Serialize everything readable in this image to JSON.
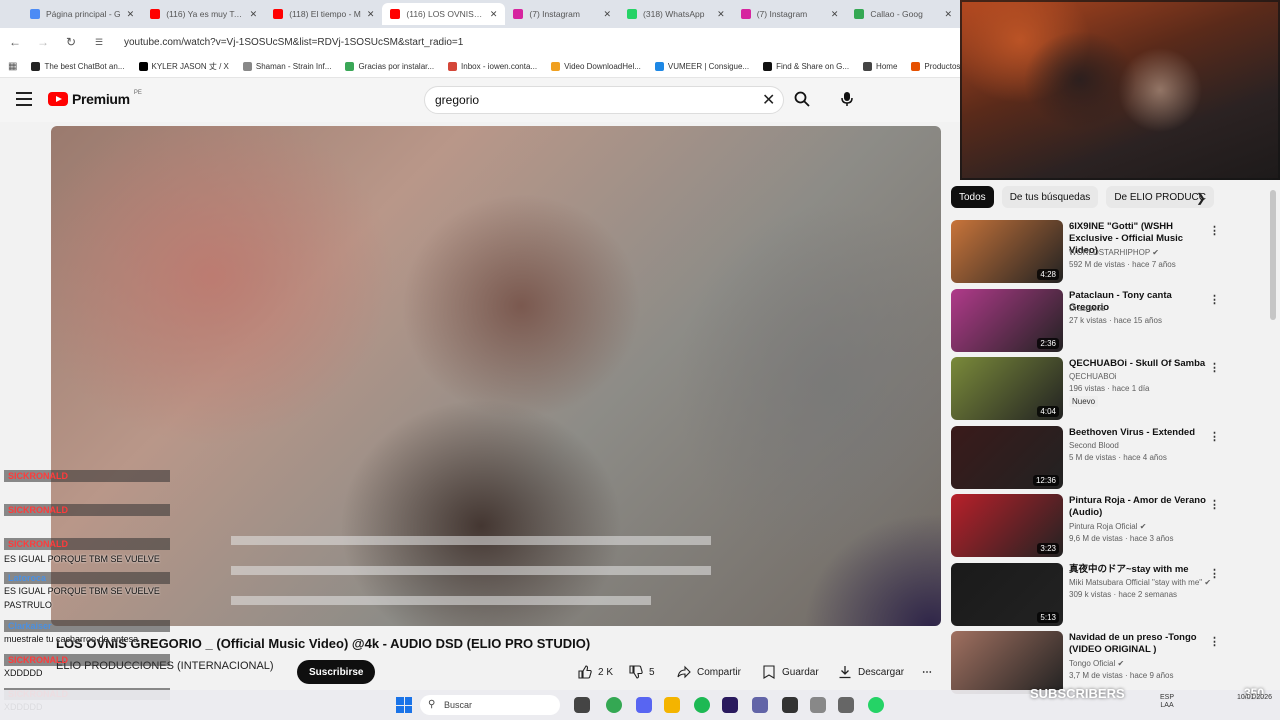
{
  "browser": {
    "tabs": [
      {
        "label": "Página principal - G",
        "color": "#4c8bf5"
      },
      {
        "label": "(116) Ya es muy Tard",
        "color": "#ff0000"
      },
      {
        "label": "(118) El tiempo - M",
        "color": "#ff0000"
      },
      {
        "label": "(116) LOS OVNIS GR",
        "color": "#ff0000",
        "active": true
      },
      {
        "label": "(7) Instagram",
        "color": "#d6249f"
      },
      {
        "label": "(318) WhatsApp",
        "color": "#25d366"
      },
      {
        "label": "(7) Instagram",
        "color": "#d6249f"
      },
      {
        "label": "Callao - Goog",
        "color": "#34a853"
      }
    ],
    "url": "youtube.com/watch?v=Vj-1SOSUcSM&list=RDVj-1SOSUcSM&start_radio=1",
    "bookmarks": [
      {
        "label": "The best ChatBot an...",
        "color": "#222222"
      },
      {
        "label": "KYLER JASON 丈 / X",
        "color": "#000000"
      },
      {
        "label": "Shaman - Strain Inf...",
        "color": "#888888"
      },
      {
        "label": "Gracias por instalar...",
        "color": "#3aa757"
      },
      {
        "label": "Inbox - iowen.conta...",
        "color": "#d44638"
      },
      {
        "label": "Video DownloadHel...",
        "color": "#f0a020"
      },
      {
        "label": "VUMEER | Consigue...",
        "color": "#1e88e5"
      },
      {
        "label": "Find & Share on G...",
        "color": "#111111"
      },
      {
        "label": "Home",
        "color": "#444444"
      },
      {
        "label": "Productos",
        "color": "#e65100"
      }
    ]
  },
  "masthead": {
    "brand": "Premium",
    "country": "PE",
    "search_value": "gregorio"
  },
  "video": {
    "title": "LOS OVNIS GREGORIO _ (Official Music Video) @4k - AUDIO DSD (ELIO PRO STUDIO)",
    "channel": "ELIO PRODUCCIONES (INTERNACIONAL)",
    "subscribe": "Suscribirse",
    "likes": "2 K",
    "dislikes": "5",
    "share": "Compartir",
    "save": "Guardar",
    "download": "Descargar"
  },
  "sidebar": {
    "chips": [
      "Todos",
      "De tus búsquedas",
      "De ELIO PRODUCC"
    ],
    "recommendations": [
      {
        "title": "6IX9INE \"Gotti\" (WSHH Exclusive - Official Music Video)",
        "channel": "WORLDSTARHIPHOP",
        "verified": true,
        "stats": "592 M de vistas · hace 7 años",
        "duration": "4:28",
        "thumb": "#c8743a",
        "badge": ""
      },
      {
        "title": "Pataclaun - Tony canta Gregorio",
        "channel": "Crasfusos",
        "verified": false,
        "stats": "27 k vistas · hace 15 años",
        "duration": "2:36",
        "thumb": "#b03a8a",
        "badge": ""
      },
      {
        "title": "QECHUABOi - Skull Of Samba",
        "channel": "QECHUABOi",
        "verified": false,
        "stats": "196 vistas · hace 1 día",
        "duration": "4:04",
        "thumb": "#7a8a3a",
        "badge": "Nuevo"
      },
      {
        "title": "Beethoven Virus - Extended",
        "channel": "Second Blood",
        "verified": false,
        "stats": "5 M de vistas · hace 4 años",
        "duration": "12:36",
        "thumb": "#3a1a1a",
        "badge": ""
      },
      {
        "title": "Pintura Roja - Amor de Verano (Audio)",
        "channel": "Pintura Roja Oficial",
        "verified": true,
        "stats": "9,6 M de vistas · hace 3 años",
        "duration": "3:23",
        "thumb": "#b8202a",
        "badge": ""
      },
      {
        "title": "真夜中のドア~stay with me",
        "channel": "Miki Matsubara Official \"stay with me\"",
        "verified": true,
        "stats": "309 k vistas · hace 2 semanas",
        "duration": "5:13",
        "thumb": "#1a1a1a",
        "badge": ""
      },
      {
        "title": "Navidad de un preso -Tongo (VIDEO ORIGINAL )",
        "channel": "Tongo Oficial",
        "verified": true,
        "stats": "3,7 M de vistas · hace 9 años",
        "duration": "",
        "thumb": "#a07060",
        "badge": ""
      }
    ]
  },
  "chat": [
    {
      "type": "user",
      "text": "SICKRONALD",
      "alt": false
    },
    {
      "type": "user",
      "text": "SICKRONALD",
      "alt": false
    },
    {
      "type": "user",
      "text": "SICKRONALD",
      "alt": false
    },
    {
      "type": "msg",
      "text": "ES IGUAL PORQUE TBM SE VUELVE"
    },
    {
      "type": "user",
      "text": "Latoroca",
      "alt": true
    },
    {
      "type": "msg",
      "text": "ES IGUAL PORQUE TBM SE VUELVE"
    },
    {
      "type": "msg",
      "text": "PASTRULO"
    },
    {
      "type": "user",
      "text": "Clarkaiser",
      "alt": true
    },
    {
      "type": "msg",
      "text": "muestrale tu cacharroo de antesa"
    },
    {
      "type": "user",
      "text": "SICKRONALD",
      "alt": false
    },
    {
      "type": "msg",
      "text": "XDDDDD"
    },
    {
      "type": "user",
      "text": "SICKRONALD",
      "alt": false
    },
    {
      "type": "msg",
      "text": "XDDDDD"
    }
  ],
  "taskbar": {
    "search_placeholder": "Buscar",
    "subs_label": "SUBSCRIBERS",
    "subs_count": "350",
    "lang_top": "ESP",
    "lang_bottom": "LAA",
    "date": "10/01/2026"
  }
}
